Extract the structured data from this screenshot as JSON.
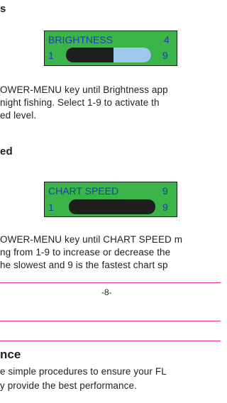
{
  "section_brightness": {
    "heading": "s",
    "display": {
      "label": "BRIGHTNESS",
      "value": "4",
      "min": "1",
      "max": "9",
      "level": 0.4444
    },
    "lines": [
      "OWER-MENU key until Brightness app",
      " night fishing. Select 1-9 to activate th",
      "ed level."
    ]
  },
  "section_chart_speed": {
    "heading": "ed",
    "display": {
      "label": "CHART  SPEED",
      "value": "9",
      "min": "1",
      "max": "9"
    },
    "lines": [
      "OWER-MENU key until CHART SPEED m",
      "ng from 1-9  to  increase or decrease the",
      "he slowest and 9 is the fastest chart sp"
    ]
  },
  "footer": {
    "page_number": "-8-"
  },
  "section_maintenance": {
    "heading": "nce",
    "lines": [
      "e simple procedures to ensure your FL",
      "y provide the best performance."
    ]
  },
  "colors": {
    "lcd_green": "#3bb54a",
    "lcd_text": "#1a3fa8",
    "rule": "#e3328f",
    "bar_fill": "#9ec7ea"
  }
}
